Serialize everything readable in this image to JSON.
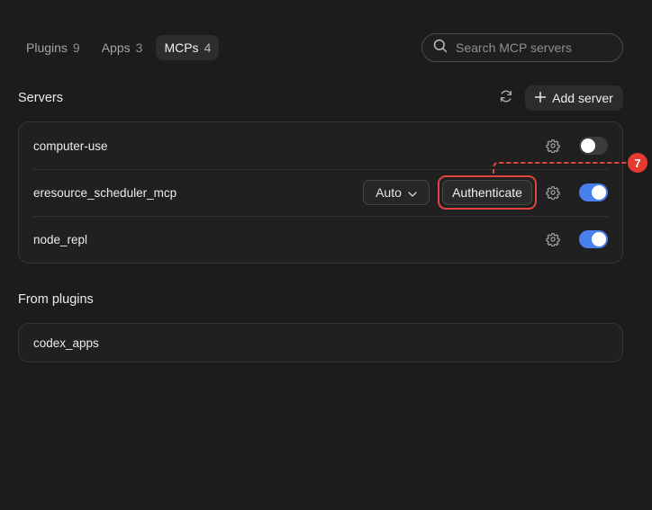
{
  "tabs": [
    {
      "label": "Plugins",
      "count": "9"
    },
    {
      "label": "Apps",
      "count": "3"
    },
    {
      "label": "MCPs",
      "count": "4"
    }
  ],
  "search": {
    "placeholder": "Search MCP servers",
    "value": ""
  },
  "servers": {
    "title": "Servers",
    "add_label": "Add server",
    "rows": [
      {
        "name": "computer-use",
        "enabled": false
      },
      {
        "name": "eresource_scheduler_mcp",
        "mode": "Auto",
        "auth_label": "Authenticate",
        "enabled": true
      },
      {
        "name": "node_repl",
        "enabled": true
      }
    ]
  },
  "plugins": {
    "title": "From plugins",
    "rows": [
      {
        "name": "codex_apps"
      }
    ]
  },
  "annotation": {
    "badge": "7",
    "color": "#e63a2f"
  },
  "colors": {
    "accent": "#4a7ff0",
    "background": "#1c1c1c"
  }
}
